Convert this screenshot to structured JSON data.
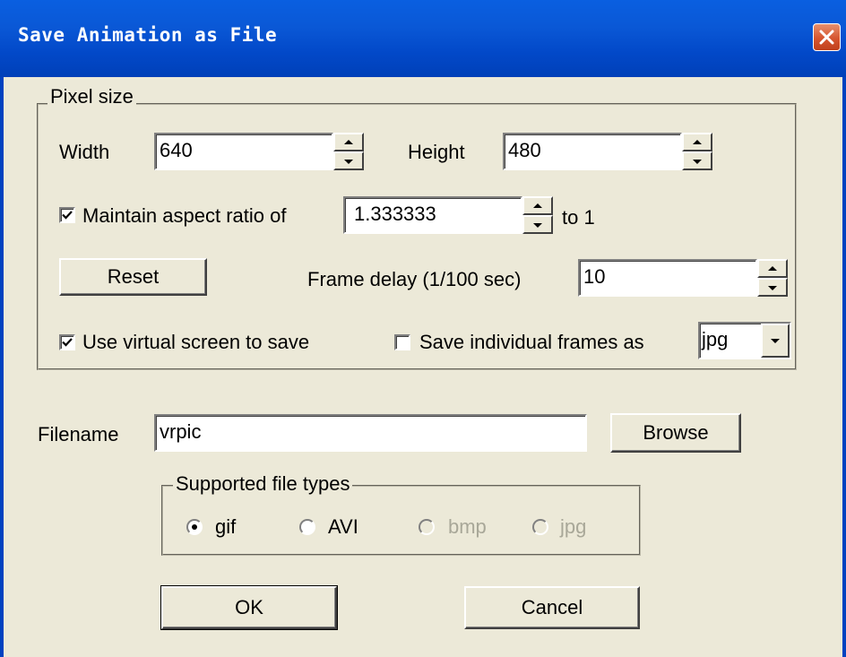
{
  "window": {
    "title": "Save Animation as File"
  },
  "pixel_size": {
    "legend": "Pixel size",
    "width_label": "Width",
    "width_value": "640",
    "height_label": "Height",
    "height_value": "480",
    "aspect_checkbox_label": "Maintain aspect ratio of",
    "aspect_checked": true,
    "aspect_value": "1.333333",
    "aspect_suffix": "to 1",
    "reset_label": "Reset",
    "frame_delay_label": "Frame delay (1/100 sec)",
    "frame_delay_value": "10",
    "virtual_screen_label": "Use virtual screen to save",
    "virtual_screen_checked": true,
    "individual_frames_label": "Save individual frames as",
    "individual_frames_checked": false,
    "frame_format_selected": "jpg"
  },
  "filename": {
    "label": "Filename",
    "value": "vrpic",
    "browse_label": "Browse"
  },
  "file_types": {
    "legend": "Supported file types",
    "options": [
      {
        "label": "gif",
        "selected": true,
        "enabled": true
      },
      {
        "label": "AVI",
        "selected": false,
        "enabled": true
      },
      {
        "label": "bmp",
        "selected": false,
        "enabled": false
      },
      {
        "label": "jpg",
        "selected": false,
        "enabled": false
      }
    ]
  },
  "actions": {
    "ok_label": "OK",
    "cancel_label": "Cancel"
  },
  "colors": {
    "titlebar": "#0a58d6",
    "dialog_bg": "#ece9d8",
    "close_button": "#d6552f"
  }
}
